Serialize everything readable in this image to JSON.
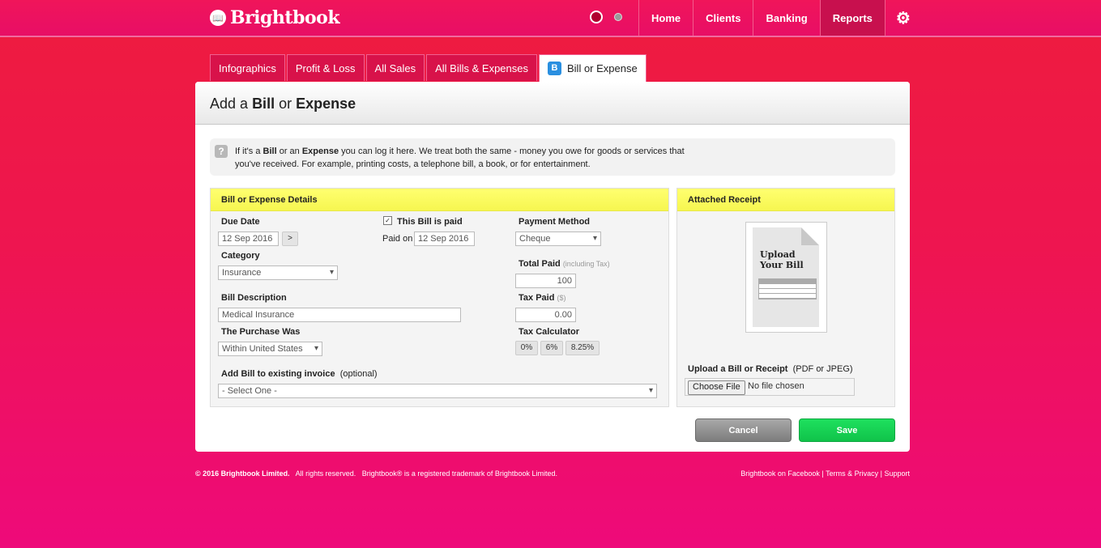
{
  "header": {
    "logo_text": "Brightbook",
    "nav": [
      "Home",
      "Clients",
      "Banking",
      "Reports"
    ],
    "active_nav": "Reports"
  },
  "tabs": [
    "Infographics",
    "Profit & Loss",
    "All Sales",
    "All Bills & Expenses",
    "Bill or Expense"
  ],
  "active_tab": "Bill or Expense",
  "tab_icon_letter": "B",
  "page_title": {
    "prefix": "Add a",
    "bill": "Bill",
    "or": "or",
    "expense": "Expense"
  },
  "info": {
    "text_1": "If it's a",
    "bill": "Bill",
    "text_2": "or an",
    "expense": "Expense",
    "text_3": "you can log it here. We treat both the same - money you owe for goods or services that you've received. For example, printing costs, a telephone bill, a book, or for entertainment."
  },
  "details": {
    "heading": "Bill or Expense Details",
    "due_date_label": "Due Date",
    "due_date_value": "12 Sep 2016",
    "due_date_next": ">",
    "paid_label": "This Bill is paid",
    "paid_checked": true,
    "paid_on_label": "Paid on",
    "paid_on_value": "12 Sep 2016",
    "payment_method_label": "Payment Method",
    "payment_method_value": "Cheque",
    "category_label": "Category",
    "category_value": "Insurance",
    "total_paid_label": "Total Paid",
    "total_paid_note": "(including Tax)",
    "total_paid_value": "100",
    "description_label": "Bill Description",
    "description_value": "Medical Insurance",
    "tax_paid_label": "Tax Paid",
    "tax_paid_note": "($)",
    "tax_paid_value": "0.00",
    "purchase_label": "The Purchase Was",
    "purchase_value": "Within United States",
    "tax_calc_label": "Tax Calculator",
    "tax_rates": [
      "0%",
      "6%",
      "8.25%"
    ],
    "invoice_label": "Add Bill to existing invoice",
    "invoice_optional": "(optional)",
    "invoice_value": "- Select One -"
  },
  "receipt": {
    "heading": "Attached Receipt",
    "doc_text_1": "Upload",
    "doc_text_2": "Your Bill",
    "upload_label": "Upload a Bill or Receipt",
    "upload_note": "(PDF or JPEG)",
    "choose_file": "Choose File",
    "file_status": "No file chosen"
  },
  "actions": {
    "cancel": "Cancel",
    "save": "Save"
  },
  "footer": {
    "copyright": "© 2016 Brightbook Limited.",
    "rights": "All rights reserved.",
    "trademark": "Brightbook® is a registered trademark of Brightbook Limited.",
    "facebook": "Brightbook on Facebook",
    "sep": "|",
    "terms": "Terms & Privacy",
    "support": "Support"
  }
}
